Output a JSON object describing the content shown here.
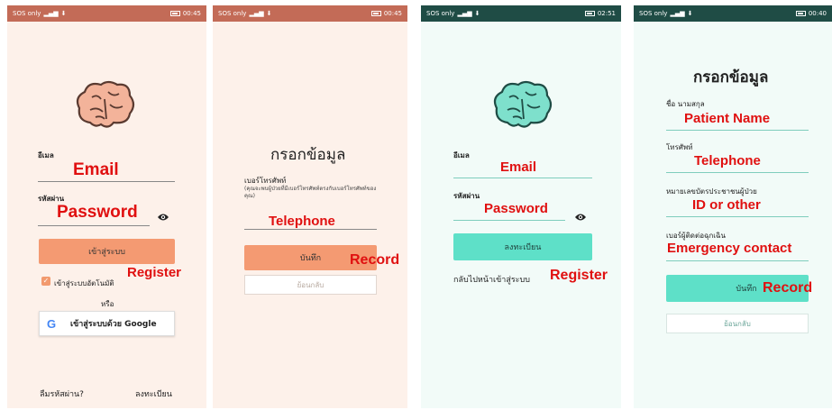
{
  "screens": [
    {
      "status": {
        "left": "SOS only",
        "time": "00:45"
      },
      "email_label": "อีเมล",
      "email_annotation": "Email",
      "password_label": "รหัสผ่าน",
      "password_annotation": "Password",
      "login_button": "เข้าสู่ระบบ",
      "register_annotation": "Register",
      "auto_login_label": "เข้าสู่ระบบอัตโนมัติ",
      "or_label": "หรือ",
      "google_button": "เข้าสู่ระบบด้วย Google",
      "forgot_password": "ลืมรหัสผ่าน?",
      "register_link": "ลงทะเบียน"
    },
    {
      "status": {
        "left": "SOS only",
        "time": "00:45"
      },
      "title": "กรอกข้อมูล",
      "phone_label": "เบอร์โทรศัพท์",
      "phone_hint": "(คุณจะพบผู้ป่วยที่มีเบอร์โทรศัพท์ตรงกับเบอร์โทรศัพท์ของคุณ)",
      "phone_annotation": "Telephone",
      "save_button": "บันทึก",
      "record_annotation": "Record",
      "back_button": "ย้อนกลับ"
    },
    {
      "status": {
        "left": "SOS only",
        "time": "02:51"
      },
      "email_label": "อีเมล",
      "email_annotation": "Email",
      "password_label": "รหัสผ่าน",
      "password_annotation": "Password",
      "register_button": "ลงทะเบียน",
      "back_to_login": "กลับไปหน้าเข้าสู่ระบบ",
      "register_annotation": "Register"
    },
    {
      "status": {
        "left": "SOS only",
        "time": "00:40"
      },
      "title": "กรอกข้อมูล",
      "name_label": "ชื่อ นามสกุล",
      "name_annotation": "Patient Name",
      "phone_label": "โทรศัพท์",
      "phone_annotation": "Telephone",
      "id_label": "หมายเลขบัตรประชาชนผู้ป่วย",
      "id_annotation": "ID or other",
      "emergency_label": "เบอร์ผู้ติดต่อฉุกเฉิน",
      "emergency_annotation": "Emergency contact",
      "save_button": "บันทึก",
      "record_annotation": "Record",
      "back_button": "ย้อนกลับ"
    }
  ],
  "colors": {
    "peach_bg": "#fdf1ea",
    "peach_button": "#f49a72",
    "mint_bg": "#f2fbf8",
    "mint_button": "#5ee0c8",
    "annotation_red": "#e01010"
  }
}
